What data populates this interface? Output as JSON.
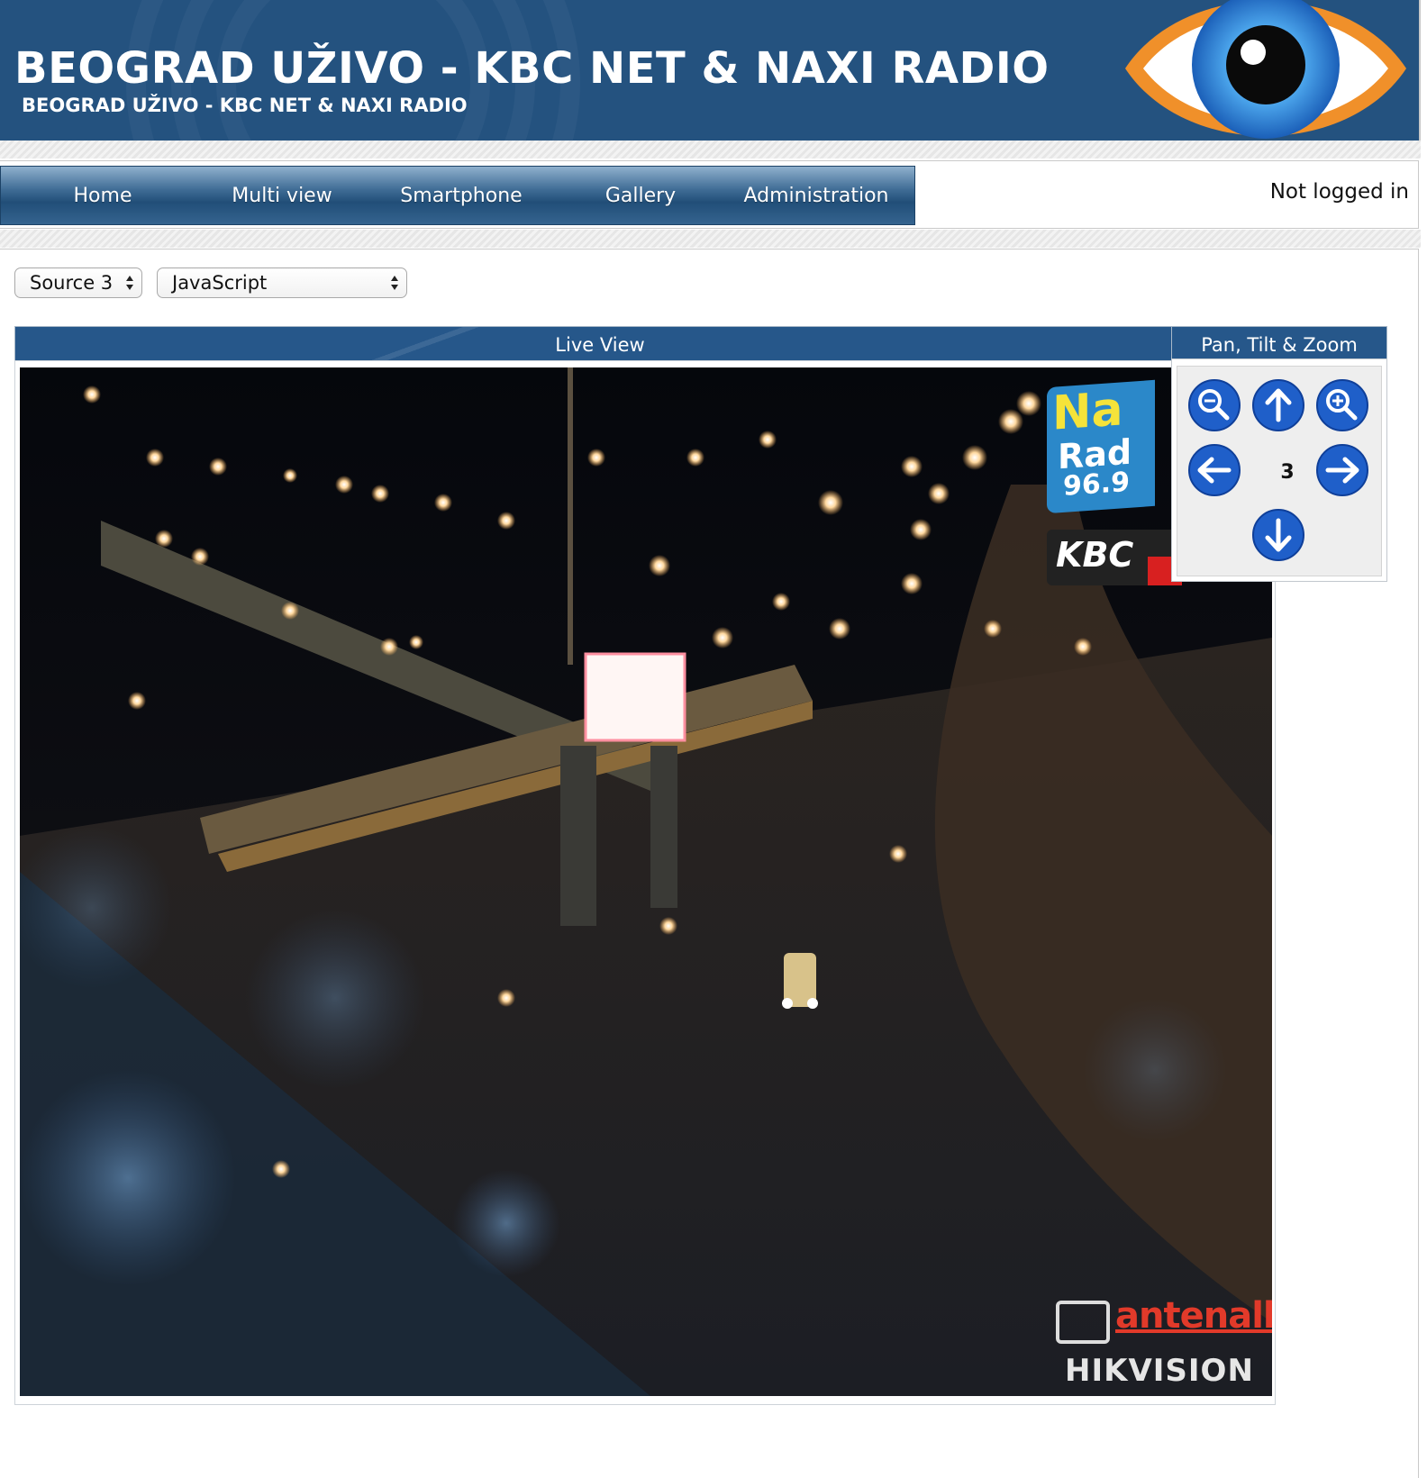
{
  "header": {
    "title": "BEOGRAD UŽIVO - KBC NET & NAXI RADIO",
    "subtitle": "BEOGRAD UŽIVO - KBC NET & NAXI RADIO",
    "logo_icon": "eye-icon"
  },
  "nav": {
    "items": [
      {
        "label": "Home"
      },
      {
        "label": "Multi view"
      },
      {
        "label": "Smartphone"
      },
      {
        "label": "Gallery"
      },
      {
        "label": "Administration"
      }
    ],
    "login_status": "Not logged in"
  },
  "controls": {
    "source_select": {
      "selected": "Source 3"
    },
    "mode_select": {
      "selected": "JavaScript"
    }
  },
  "live_view": {
    "title": "Live View",
    "overlays": {
      "sign_naxi": "Na",
      "sign_radio": "Rad",
      "sign_freq": "96.9",
      "sign_kbc": "KBC",
      "watermark_brand": "antenall",
      "watermark_vendor": "HIKVISION"
    }
  },
  "ptz": {
    "title": "Pan, Tilt & Zoom",
    "preset": "3",
    "buttons": {
      "zoom_out": "zoom-out-icon",
      "up": "arrow-up-icon",
      "zoom_in": "zoom-in-icon",
      "left": "arrow-left-icon",
      "right": "arrow-right-icon",
      "down": "arrow-down-icon"
    }
  },
  "colors": {
    "brand_blue": "#24527f",
    "nav_blue": "#214e78",
    "ptz_button": "#1f5fc9",
    "eye_orange": "#f0902a"
  }
}
